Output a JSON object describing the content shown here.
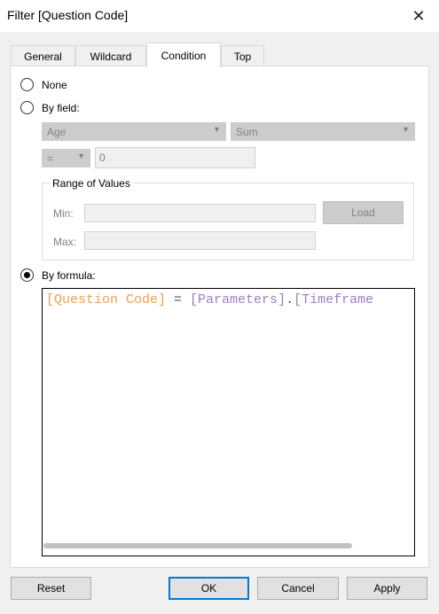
{
  "window": {
    "title": "Filter [Question Code]",
    "close_glyph": "✕"
  },
  "tabs": [
    {
      "label": "General"
    },
    {
      "label": "Wildcard"
    },
    {
      "label": "Condition",
      "active": true
    },
    {
      "label": "Top"
    }
  ],
  "condition": {
    "none_label": "None",
    "by_field_label": "By field:",
    "field_value": "Age",
    "aggregation_value": "Sum",
    "operator_value": "=",
    "compare_value": "0",
    "range_title": "Range of Values",
    "min_label": "Min:",
    "max_label": "Max:",
    "load_label": "Load",
    "by_formula_label": "By formula:",
    "selected": "by_formula",
    "formula": {
      "field": "[Question Code]",
      "op": " = ",
      "param_ns": "[Parameters]",
      "dot": ".",
      "param": "[Timeframe"
    }
  },
  "buttons": {
    "reset": "Reset",
    "ok": "OK",
    "cancel": "Cancel",
    "apply": "Apply"
  },
  "colors": {
    "formula_field": "#f0a050",
    "formula_param": "#9b7fc6",
    "default_button_border": "#0078d7"
  }
}
